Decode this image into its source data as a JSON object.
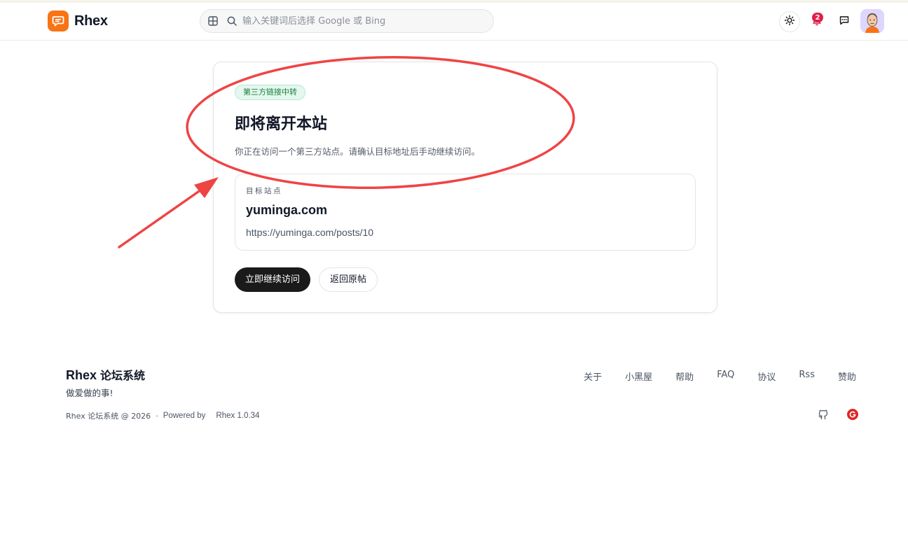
{
  "header": {
    "brand": "Rhex",
    "search_placeholder": "输入关键词后选择 Google 或 Bing",
    "notification_count": "2"
  },
  "card": {
    "tag": "第三方链接中转",
    "title": "即将离开本站",
    "description": "你正在访问一个第三方站点。请确认目标地址后手动继续访问。",
    "target_label": "目标站点",
    "target_domain": "yuminga.com",
    "target_url": "https://yuminga.com/posts/10",
    "continue_button": "立即继续访问",
    "back_button": "返回原帖"
  },
  "footer": {
    "title_latin": "Rhex ",
    "title_cjk": "论坛系统",
    "slogan": "做爱做的事!",
    "links": [
      "关于",
      "小黑屋",
      "帮助",
      "FAQ",
      "协议",
      "Rss",
      "赞助"
    ],
    "copyright": "Rhex 论坛系统 @ 2026",
    "separator": "·",
    "powered_by": "Powered by",
    "version": "Rhex 1.0.34"
  },
  "colors": {
    "brand": "#f97316",
    "annotation": "#ef4444",
    "primary_button": "#1a1a1a",
    "tag_green": "#16803c",
    "badge": "#e11d48"
  },
  "icons": [
    "chat-bubble-logo-icon",
    "grid-icon",
    "search-icon",
    "sun-icon",
    "bell-icon",
    "message-icon",
    "github-icon",
    "g-circle-icon"
  ]
}
